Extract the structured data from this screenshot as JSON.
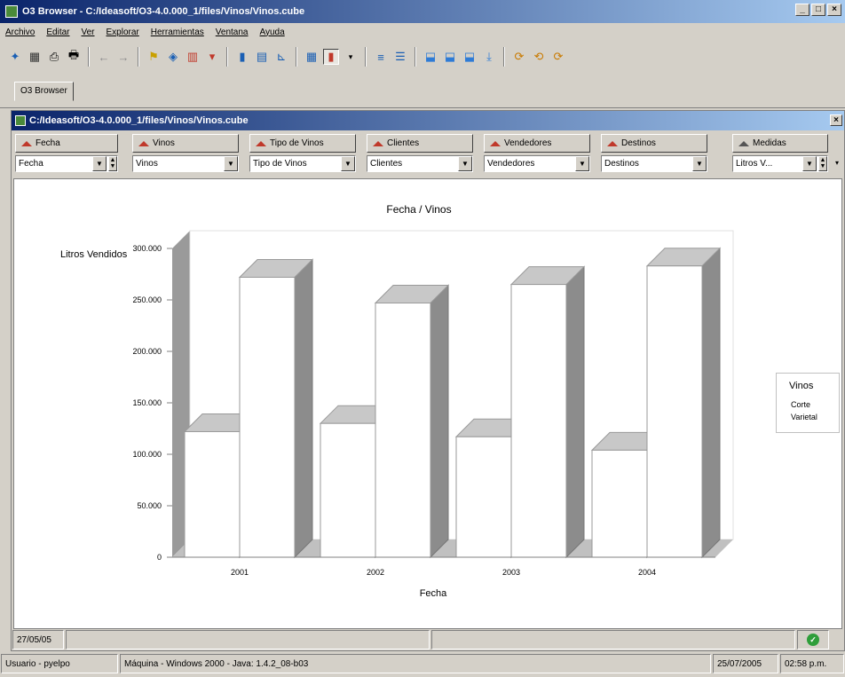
{
  "window": {
    "title": "O3 Browser - C:/Ideasoft/O3-4.0.000_1/files/Vinos/Vinos.cube",
    "controls": [
      "_",
      "□",
      "×"
    ]
  },
  "menu": [
    "Archivo",
    "Editar",
    "Ver",
    "Explorar",
    "Herramientas",
    "Ventana",
    "Ayuda"
  ],
  "toolbar_icons": [
    "new-icon",
    "open-icon",
    "print-preview-icon",
    "print-icon",
    "back-icon",
    "forward-icon",
    "tree-icon",
    "cube-icon",
    "table-chart-icon",
    "filter-icon",
    "bar-chart-icon",
    "stacked-bar-icon",
    "line-chart-icon",
    "grid-icon",
    "3d-bar-icon",
    "dropdown-icon",
    "align-left-icon",
    "align-center-icon",
    "export-icon",
    "export2-icon",
    "export3-icon",
    "export4-icon",
    "refresh-icon",
    "refresh2-icon",
    "refresh3-icon"
  ],
  "tab": {
    "label": "O3 Browser"
  },
  "inner": {
    "title": "C:/Ideasoft/O3-4.0.000_1/files/Vinos/Vinos.cube",
    "close": "×"
  },
  "dimensions": [
    {
      "button": "Fecha",
      "value": "Fecha"
    },
    {
      "button": "Vinos",
      "value": "Vinos"
    },
    {
      "button": "Tipo de Vinos",
      "value": "Tipo de Vinos"
    },
    {
      "button": "Clientes",
      "value": "Clientes"
    },
    {
      "button": "Vendedores",
      "value": "Vendedores"
    },
    {
      "button": "Destinos",
      "value": "Destinos"
    },
    {
      "button": "Medidas",
      "value": "Litros V..."
    }
  ],
  "chart_data": {
    "type": "bar",
    "title": "Fecha / Vinos",
    "xlabel": "Fecha",
    "ylabel": "Litros Vendidos",
    "categories": [
      "2001",
      "2002",
      "2003",
      "2004"
    ],
    "ylim": [
      0,
      300000
    ],
    "yticks": [
      "0",
      "50.000",
      "100.000",
      "150.000",
      "200.000",
      "250.000",
      "300.000"
    ],
    "series": [
      {
        "name": "Corte",
        "values": [
          122000,
          130000,
          117000,
          104000
        ]
      },
      {
        "name": "Varietal",
        "values": [
          272000,
          247000,
          265000,
          283000
        ]
      }
    ],
    "legend": {
      "title": "Vinos",
      "position": "right"
    },
    "three_d": true,
    "colors": {
      "face": "#ffffff",
      "side": "#8c8c8c",
      "top": "#c8c8c8",
      "wall": "#9a9a9a",
      "floor": "#c0c0c0"
    }
  },
  "status_inner": {
    "date": "27/05/05"
  },
  "status_bottom": {
    "user": "Usuario - pyelpo",
    "machine": "Máquina - Windows 2000 - Java: 1.4.2_08-b03",
    "date": "25/07/2005",
    "time": "02:58 p.m."
  }
}
